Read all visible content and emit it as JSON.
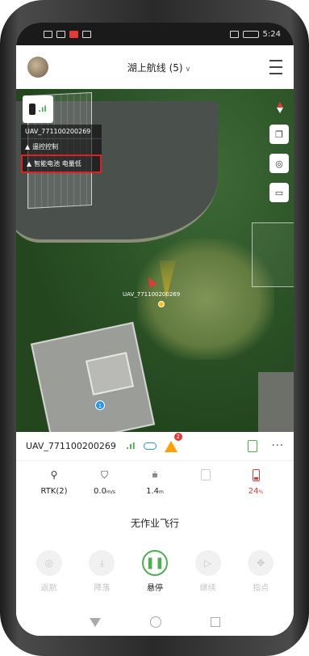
{
  "status_bar": {
    "time": "5:24"
  },
  "header": {
    "route_title": "湖上航线 (5)"
  },
  "map": {
    "uav_id": "UAV_771100200269",
    "warnings": [
      {
        "label": "遥控控制",
        "highlighted": false
      },
      {
        "label": "智能电池 电量低",
        "highlighted": true
      }
    ],
    "drone_label": "UAV_771100200269",
    "waypoint_marker": "1"
  },
  "panel": {
    "drone_name": "UAV_771100200269",
    "warning_count": "2",
    "stats": [
      {
        "icon": "satellite-icon",
        "value": "RTK(2)",
        "unit": ""
      },
      {
        "icon": "shield-speed-icon",
        "value": "0.0",
        "unit": "m/s"
      },
      {
        "icon": "altitude-icon",
        "value": "1.4",
        "unit": "m"
      },
      {
        "icon": "payload-icon",
        "value": "",
        "unit": ""
      },
      {
        "icon": "battery-icon",
        "value": "24",
        "unit": "%"
      }
    ],
    "status_text": "无作业飞行",
    "actions": [
      {
        "label": "返航",
        "icon": "return-home-icon",
        "active": false
      },
      {
        "label": "降落",
        "icon": "land-icon",
        "active": false
      },
      {
        "label": "悬停",
        "icon": "pause-icon",
        "active": true
      },
      {
        "label": "继续",
        "icon": "resume-icon",
        "active": false
      },
      {
        "label": "指点",
        "icon": "point-icon",
        "active": false
      }
    ]
  },
  "colors": {
    "accent_green": "#4caf50",
    "warning_red": "#e53935",
    "warning_orange": "#ffa000"
  }
}
